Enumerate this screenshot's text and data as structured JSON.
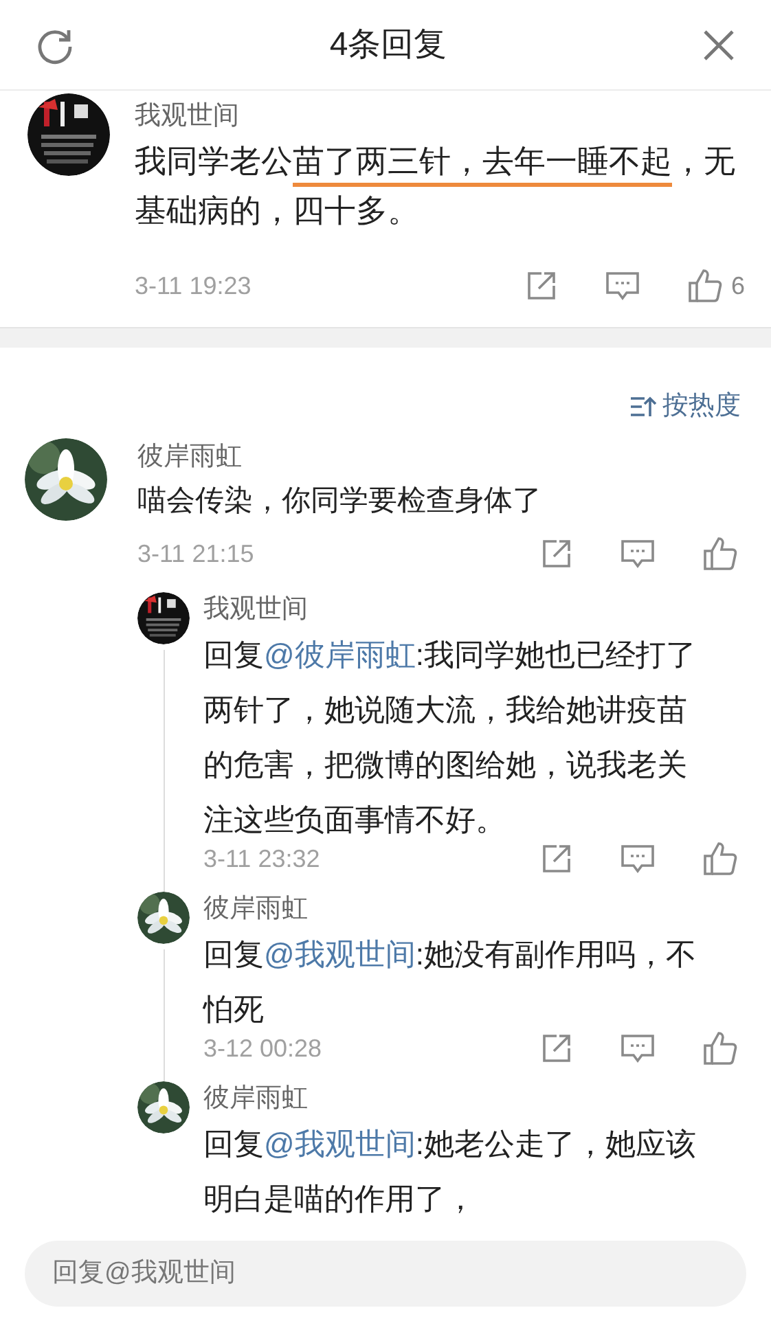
{
  "header": {
    "title": "4条回复"
  },
  "root_comment": {
    "author": "我观世间",
    "text_parts": [
      {
        "text": "我同学老公",
        "underlined": false
      },
      {
        "text": "苗了两三针，去年一睡不起",
        "underlined": true
      },
      {
        "text": "，无基础病的，四十多。",
        "underlined": false
      }
    ],
    "time": "3-11 19:23",
    "like_count": "6"
  },
  "sort": {
    "label": "按热度"
  },
  "comment": {
    "author": "彼岸雨虹",
    "text": "喵会传染，你同学要检查身体了",
    "time": "3-11 21:15"
  },
  "replies": [
    {
      "author": "我观世间",
      "prefix": "回复",
      "mention": "@彼岸雨虹",
      "text": ":我同学她也已经打了两针了，她说随大流，我给她讲疫苗的危害，把微博的图给她，说我老关注这些负面事情不好。",
      "time": "3-11 23:32"
    },
    {
      "author": "彼岸雨虹",
      "prefix": "回复",
      "mention": "@我观世间",
      "text": ":她没有副作用吗，不怕死",
      "time": "3-12 00:28"
    },
    {
      "author": "彼岸雨虹",
      "prefix": "回复",
      "mention": "@我观世间",
      "text": ":她老公走了，她应该明白是喵的作用了，"
    }
  ],
  "reply_box": {
    "placeholder": "回复@我观世间"
  }
}
